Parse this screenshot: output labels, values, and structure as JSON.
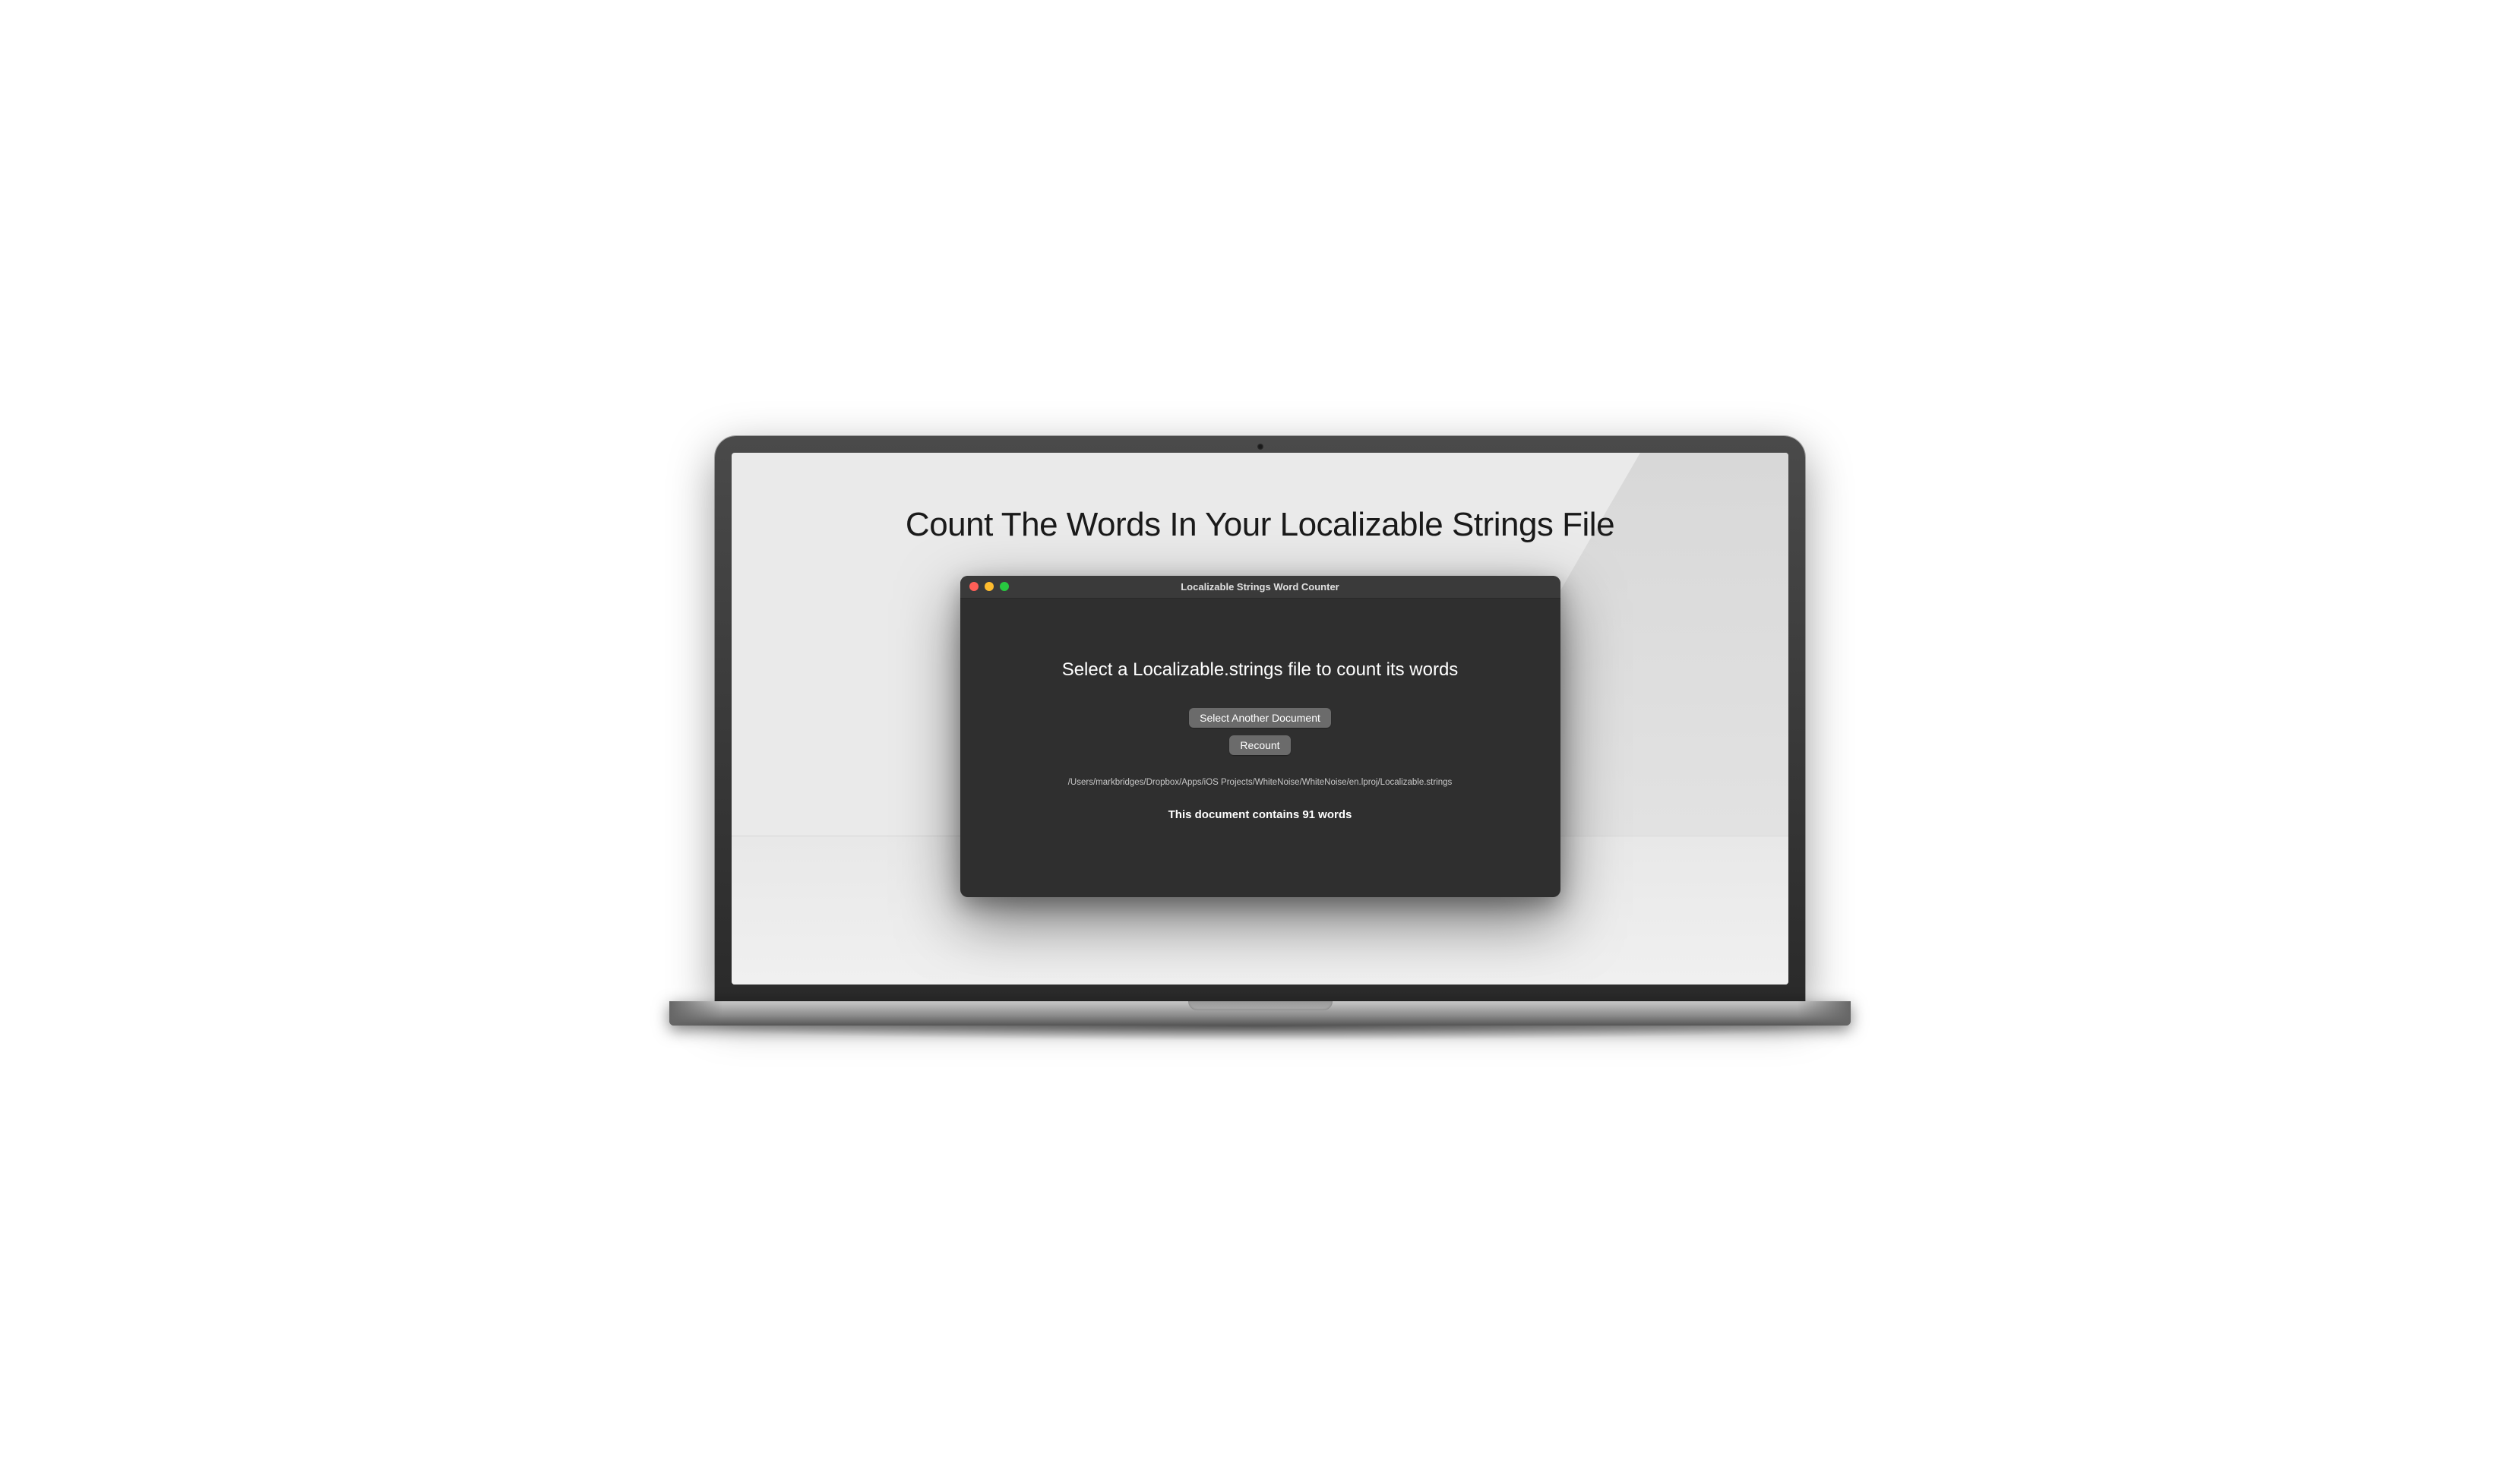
{
  "page": {
    "heading": "Count The Words In Your Localizable Strings File"
  },
  "window": {
    "title": "Localizable Strings Word Counter",
    "instruction": "Select a Localizable.strings file to count its words",
    "buttons": {
      "select_another": "Select Another Document",
      "recount": "Recount"
    },
    "file_path": "/Users/markbridges/Dropbox/Apps/iOS Projects/WhiteNoise/WhiteNoise/en.lproj/Localizable.strings",
    "result": "This document contains 91 words"
  }
}
